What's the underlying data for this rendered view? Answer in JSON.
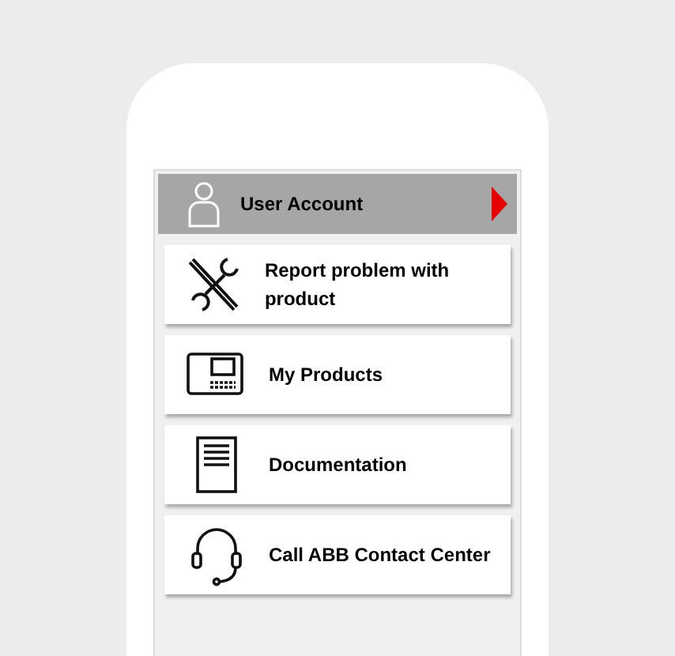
{
  "header": {
    "title": "User Account"
  },
  "menu_items": [
    {
      "kind": "tools",
      "label": "Report problem with product"
    },
    {
      "kind": "device",
      "label": "My Products"
    },
    {
      "kind": "document",
      "label": "Documentation"
    },
    {
      "kind": "headset",
      "label": "Call ABB Contact Center"
    }
  ]
}
